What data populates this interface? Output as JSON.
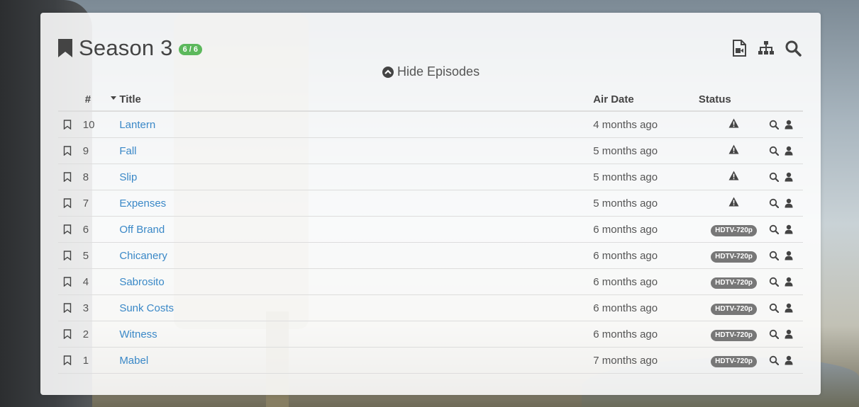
{
  "season": {
    "title": "Season 3",
    "count_badge": "6 / 6",
    "toggle_label": "Hide Episodes"
  },
  "header_icons": [
    "video-file-icon",
    "sitemap-icon",
    "search-icon"
  ],
  "table": {
    "columns": {
      "number": "#",
      "title": "Title",
      "air_date": "Air Date",
      "status": "Status"
    },
    "rows": [
      {
        "num": "10",
        "title": "Lantern",
        "air": "4 months ago",
        "status": "missing",
        "quality": ""
      },
      {
        "num": "9",
        "title": "Fall",
        "air": "5 months ago",
        "status": "missing",
        "quality": ""
      },
      {
        "num": "8",
        "title": "Slip",
        "air": "5 months ago",
        "status": "missing",
        "quality": ""
      },
      {
        "num": "7",
        "title": "Expenses",
        "air": "5 months ago",
        "status": "missing",
        "quality": ""
      },
      {
        "num": "6",
        "title": "Off Brand",
        "air": "6 months ago",
        "status": "downloaded",
        "quality": "HDTV-720p"
      },
      {
        "num": "5",
        "title": "Chicanery",
        "air": "6 months ago",
        "status": "downloaded",
        "quality": "HDTV-720p"
      },
      {
        "num": "4",
        "title": "Sabrosito",
        "air": "6 months ago",
        "status": "downloaded",
        "quality": "HDTV-720p"
      },
      {
        "num": "3",
        "title": "Sunk Costs",
        "air": "6 months ago",
        "status": "downloaded",
        "quality": "HDTV-720p"
      },
      {
        "num": "2",
        "title": "Witness",
        "air": "6 months ago",
        "status": "downloaded",
        "quality": "HDTV-720p"
      },
      {
        "num": "1",
        "title": "Mabel",
        "air": "7 months ago",
        "status": "downloaded",
        "quality": "HDTV-720p"
      }
    ]
  },
  "colors": {
    "accent_link": "#3a88c7",
    "count_badge_bg": "#5cb85c",
    "quality_badge_bg": "#777777"
  }
}
